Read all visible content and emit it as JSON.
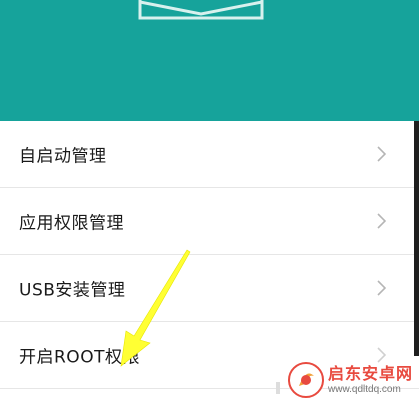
{
  "colors": {
    "header_bg": "#16a39b",
    "emblem_stroke": "#d8f1ee",
    "text": "#1a1a1a",
    "chevron": "#b5b5b5",
    "divider": "#e6e6e6",
    "arrow_fill": "#ffff33",
    "watermark_red": "#e84a3f"
  },
  "header": {
    "emblem_icon": "envelope-emblem-icon"
  },
  "menu": {
    "items": [
      {
        "label": "自启动管理",
        "icon": "chevron-right-icon"
      },
      {
        "label": "应用权限管理",
        "icon": "chevron-right-icon"
      },
      {
        "label": "USB安装管理",
        "icon": "chevron-right-icon"
      },
      {
        "label": "开启ROOT权限",
        "icon": "chevron-right-icon"
      }
    ]
  },
  "annotation": {
    "icon": "yellow-arrow-annotation"
  },
  "watermark": {
    "title": "启东安卓网",
    "url": "www.qdltdq.com",
    "logo_icon": "watermark-logo-icon"
  }
}
